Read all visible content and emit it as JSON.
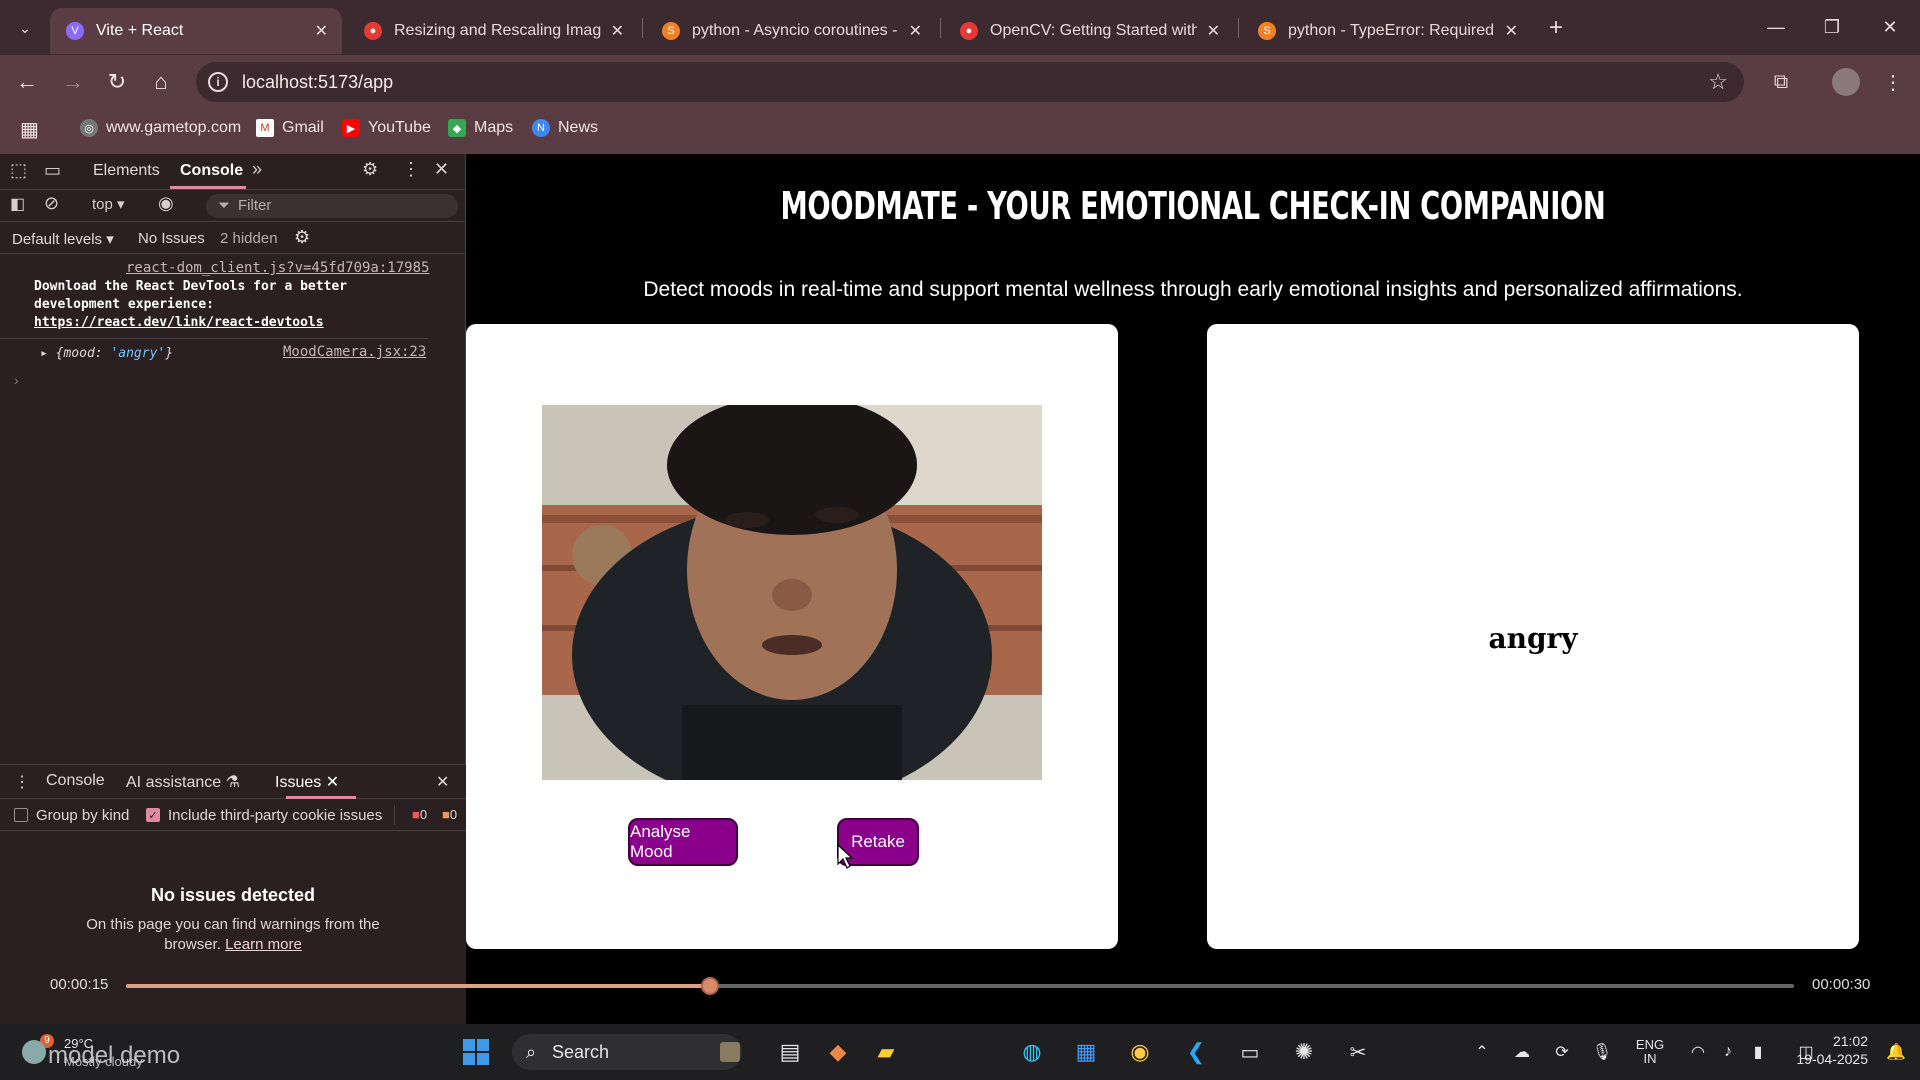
{
  "browser": {
    "tabs": [
      {
        "title": "Vite + React",
        "active": true
      },
      {
        "title": "Resizing and Rescaling Images",
        "active": false
      },
      {
        "title": "python - Asyncio coroutines - S",
        "active": false
      },
      {
        "title": "OpenCV: Getting Started with I",
        "active": false
      },
      {
        "title": "python - TypeError: Required ar",
        "active": false
      }
    ],
    "url": "localhost:5173/app",
    "bookmarks": [
      "www.gametop.com",
      "Gmail",
      "YouTube",
      "Maps",
      "News"
    ]
  },
  "devtools": {
    "tabs": {
      "elements": "Elements",
      "console": "Console"
    },
    "context": "top",
    "filter_placeholder": "Filter",
    "levels": "Default levels",
    "issues": "No Issues",
    "hidden": "2 hidden",
    "messages": {
      "source1": "react-dom_client.js?v=45fd709a:17985",
      "text1": "Download the React DevTools for a better development experience:",
      "link1": "https://react.dev/link/react-devtools",
      "source2": "MoodCamera.jsx:23",
      "obj_key": "mood",
      "obj_value": "'angry'"
    },
    "drawer": {
      "tabs": {
        "console": "Console",
        "ai": "AI assistance",
        "issues": "Issues"
      },
      "group_by_kind": "Group by kind",
      "third_party": "Include third-party cookie issues",
      "counts": [
        "0",
        "0"
      ],
      "no_issues_title": "No issues detected",
      "no_issues_desc": "On this page you can find warnings from the browser.",
      "learn_more": "Learn more"
    }
  },
  "app": {
    "title": "MOODMATE - YOUR EMOTIONAL CHECK-IN COMPANION",
    "subtitle": "Detect moods in real-time and support mental wellness through early emotional insights and personalized affirmations.",
    "analyse_button": "Analyse Mood",
    "retake_button": "Retake",
    "mood_result": "angry"
  },
  "video": {
    "current_time": "00:00:15",
    "total_time": "00:00:30",
    "progress": 0.35
  },
  "taskbar": {
    "weather_temp": "29°C",
    "weather_desc": "Mostly cloudy",
    "weather_badge": "9",
    "watermark": "model demo",
    "search": "Search",
    "lang1": "ENG",
    "lang2": "IN",
    "time": "21:02",
    "date": "19-04-2025"
  },
  "colors": {
    "accent_button": "#8a008a",
    "chrome": "#5a3c45"
  }
}
